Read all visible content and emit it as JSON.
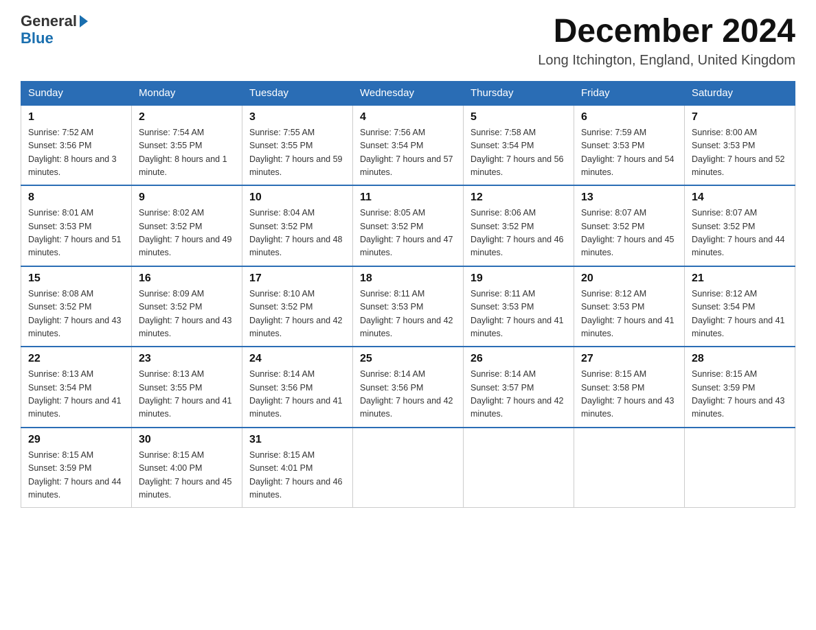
{
  "header": {
    "logo_general": "General",
    "logo_blue": "Blue",
    "month_year": "December 2024",
    "location": "Long Itchington, England, United Kingdom"
  },
  "days_of_week": [
    "Sunday",
    "Monday",
    "Tuesday",
    "Wednesday",
    "Thursday",
    "Friday",
    "Saturday"
  ],
  "weeks": [
    [
      {
        "day": "1",
        "sunrise": "Sunrise: 7:52 AM",
        "sunset": "Sunset: 3:56 PM",
        "daylight": "Daylight: 8 hours and 3 minutes."
      },
      {
        "day": "2",
        "sunrise": "Sunrise: 7:54 AM",
        "sunset": "Sunset: 3:55 PM",
        "daylight": "Daylight: 8 hours and 1 minute."
      },
      {
        "day": "3",
        "sunrise": "Sunrise: 7:55 AM",
        "sunset": "Sunset: 3:55 PM",
        "daylight": "Daylight: 7 hours and 59 minutes."
      },
      {
        "day": "4",
        "sunrise": "Sunrise: 7:56 AM",
        "sunset": "Sunset: 3:54 PM",
        "daylight": "Daylight: 7 hours and 57 minutes."
      },
      {
        "day": "5",
        "sunrise": "Sunrise: 7:58 AM",
        "sunset": "Sunset: 3:54 PM",
        "daylight": "Daylight: 7 hours and 56 minutes."
      },
      {
        "day": "6",
        "sunrise": "Sunrise: 7:59 AM",
        "sunset": "Sunset: 3:53 PM",
        "daylight": "Daylight: 7 hours and 54 minutes."
      },
      {
        "day": "7",
        "sunrise": "Sunrise: 8:00 AM",
        "sunset": "Sunset: 3:53 PM",
        "daylight": "Daylight: 7 hours and 52 minutes."
      }
    ],
    [
      {
        "day": "8",
        "sunrise": "Sunrise: 8:01 AM",
        "sunset": "Sunset: 3:53 PM",
        "daylight": "Daylight: 7 hours and 51 minutes."
      },
      {
        "day": "9",
        "sunrise": "Sunrise: 8:02 AM",
        "sunset": "Sunset: 3:52 PM",
        "daylight": "Daylight: 7 hours and 49 minutes."
      },
      {
        "day": "10",
        "sunrise": "Sunrise: 8:04 AM",
        "sunset": "Sunset: 3:52 PM",
        "daylight": "Daylight: 7 hours and 48 minutes."
      },
      {
        "day": "11",
        "sunrise": "Sunrise: 8:05 AM",
        "sunset": "Sunset: 3:52 PM",
        "daylight": "Daylight: 7 hours and 47 minutes."
      },
      {
        "day": "12",
        "sunrise": "Sunrise: 8:06 AM",
        "sunset": "Sunset: 3:52 PM",
        "daylight": "Daylight: 7 hours and 46 minutes."
      },
      {
        "day": "13",
        "sunrise": "Sunrise: 8:07 AM",
        "sunset": "Sunset: 3:52 PM",
        "daylight": "Daylight: 7 hours and 45 minutes."
      },
      {
        "day": "14",
        "sunrise": "Sunrise: 8:07 AM",
        "sunset": "Sunset: 3:52 PM",
        "daylight": "Daylight: 7 hours and 44 minutes."
      }
    ],
    [
      {
        "day": "15",
        "sunrise": "Sunrise: 8:08 AM",
        "sunset": "Sunset: 3:52 PM",
        "daylight": "Daylight: 7 hours and 43 minutes."
      },
      {
        "day": "16",
        "sunrise": "Sunrise: 8:09 AM",
        "sunset": "Sunset: 3:52 PM",
        "daylight": "Daylight: 7 hours and 43 minutes."
      },
      {
        "day": "17",
        "sunrise": "Sunrise: 8:10 AM",
        "sunset": "Sunset: 3:52 PM",
        "daylight": "Daylight: 7 hours and 42 minutes."
      },
      {
        "day": "18",
        "sunrise": "Sunrise: 8:11 AM",
        "sunset": "Sunset: 3:53 PM",
        "daylight": "Daylight: 7 hours and 42 minutes."
      },
      {
        "day": "19",
        "sunrise": "Sunrise: 8:11 AM",
        "sunset": "Sunset: 3:53 PM",
        "daylight": "Daylight: 7 hours and 41 minutes."
      },
      {
        "day": "20",
        "sunrise": "Sunrise: 8:12 AM",
        "sunset": "Sunset: 3:53 PM",
        "daylight": "Daylight: 7 hours and 41 minutes."
      },
      {
        "day": "21",
        "sunrise": "Sunrise: 8:12 AM",
        "sunset": "Sunset: 3:54 PM",
        "daylight": "Daylight: 7 hours and 41 minutes."
      }
    ],
    [
      {
        "day": "22",
        "sunrise": "Sunrise: 8:13 AM",
        "sunset": "Sunset: 3:54 PM",
        "daylight": "Daylight: 7 hours and 41 minutes."
      },
      {
        "day": "23",
        "sunrise": "Sunrise: 8:13 AM",
        "sunset": "Sunset: 3:55 PM",
        "daylight": "Daylight: 7 hours and 41 minutes."
      },
      {
        "day": "24",
        "sunrise": "Sunrise: 8:14 AM",
        "sunset": "Sunset: 3:56 PM",
        "daylight": "Daylight: 7 hours and 41 minutes."
      },
      {
        "day": "25",
        "sunrise": "Sunrise: 8:14 AM",
        "sunset": "Sunset: 3:56 PM",
        "daylight": "Daylight: 7 hours and 42 minutes."
      },
      {
        "day": "26",
        "sunrise": "Sunrise: 8:14 AM",
        "sunset": "Sunset: 3:57 PM",
        "daylight": "Daylight: 7 hours and 42 minutes."
      },
      {
        "day": "27",
        "sunrise": "Sunrise: 8:15 AM",
        "sunset": "Sunset: 3:58 PM",
        "daylight": "Daylight: 7 hours and 43 minutes."
      },
      {
        "day": "28",
        "sunrise": "Sunrise: 8:15 AM",
        "sunset": "Sunset: 3:59 PM",
        "daylight": "Daylight: 7 hours and 43 minutes."
      }
    ],
    [
      {
        "day": "29",
        "sunrise": "Sunrise: 8:15 AM",
        "sunset": "Sunset: 3:59 PM",
        "daylight": "Daylight: 7 hours and 44 minutes."
      },
      {
        "day": "30",
        "sunrise": "Sunrise: 8:15 AM",
        "sunset": "Sunset: 4:00 PM",
        "daylight": "Daylight: 7 hours and 45 minutes."
      },
      {
        "day": "31",
        "sunrise": "Sunrise: 8:15 AM",
        "sunset": "Sunset: 4:01 PM",
        "daylight": "Daylight: 7 hours and 46 minutes."
      },
      null,
      null,
      null,
      null
    ]
  ]
}
